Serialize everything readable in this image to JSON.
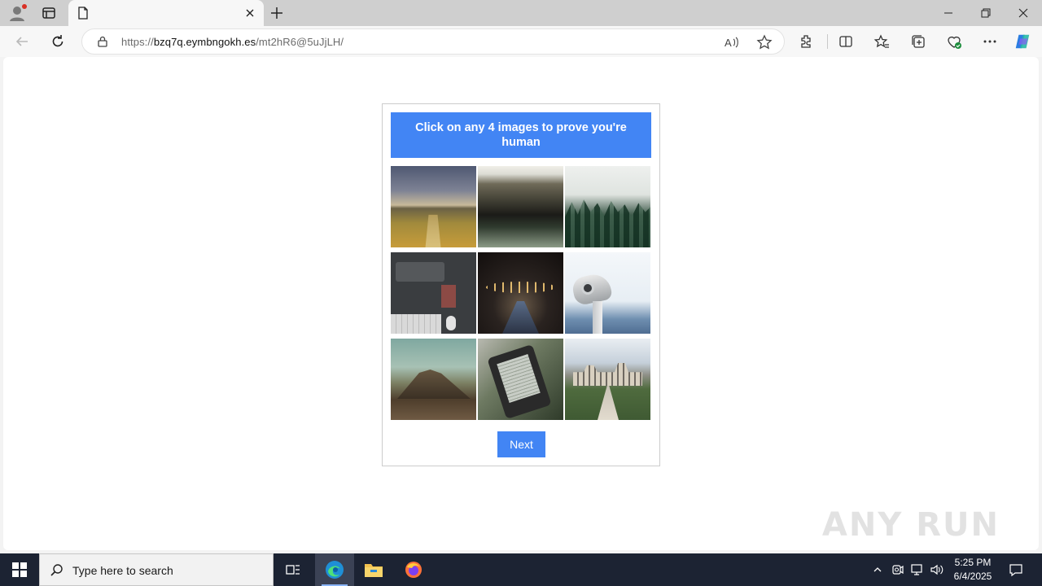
{
  "browser": {
    "tab": {
      "title": ""
    },
    "address": {
      "scheme": "https://",
      "host": "bzq7q.eymbngokh.es",
      "path": "/mt2hR6@5uJjLH/"
    }
  },
  "captcha": {
    "instruction": "Click on any 4 images to prove you're human",
    "images": [
      {
        "name": "wheat-field-road"
      },
      {
        "name": "misty-meadow"
      },
      {
        "name": "foggy-forest"
      },
      {
        "name": "desk-keyboard"
      },
      {
        "name": "night-street-lights"
      },
      {
        "name": "coin-binoculars"
      },
      {
        "name": "volcano-landscape"
      },
      {
        "name": "ereader-in-hand"
      },
      {
        "name": "chateau-path"
      }
    ],
    "next_label": "Next"
  },
  "watermark": "ANY RUN",
  "taskbar": {
    "search_placeholder": "Type here to search",
    "time": "5:25 PM",
    "date": "6/4/2025"
  },
  "colors": {
    "accent": "#4285f4",
    "taskbar": "#1c2333"
  }
}
